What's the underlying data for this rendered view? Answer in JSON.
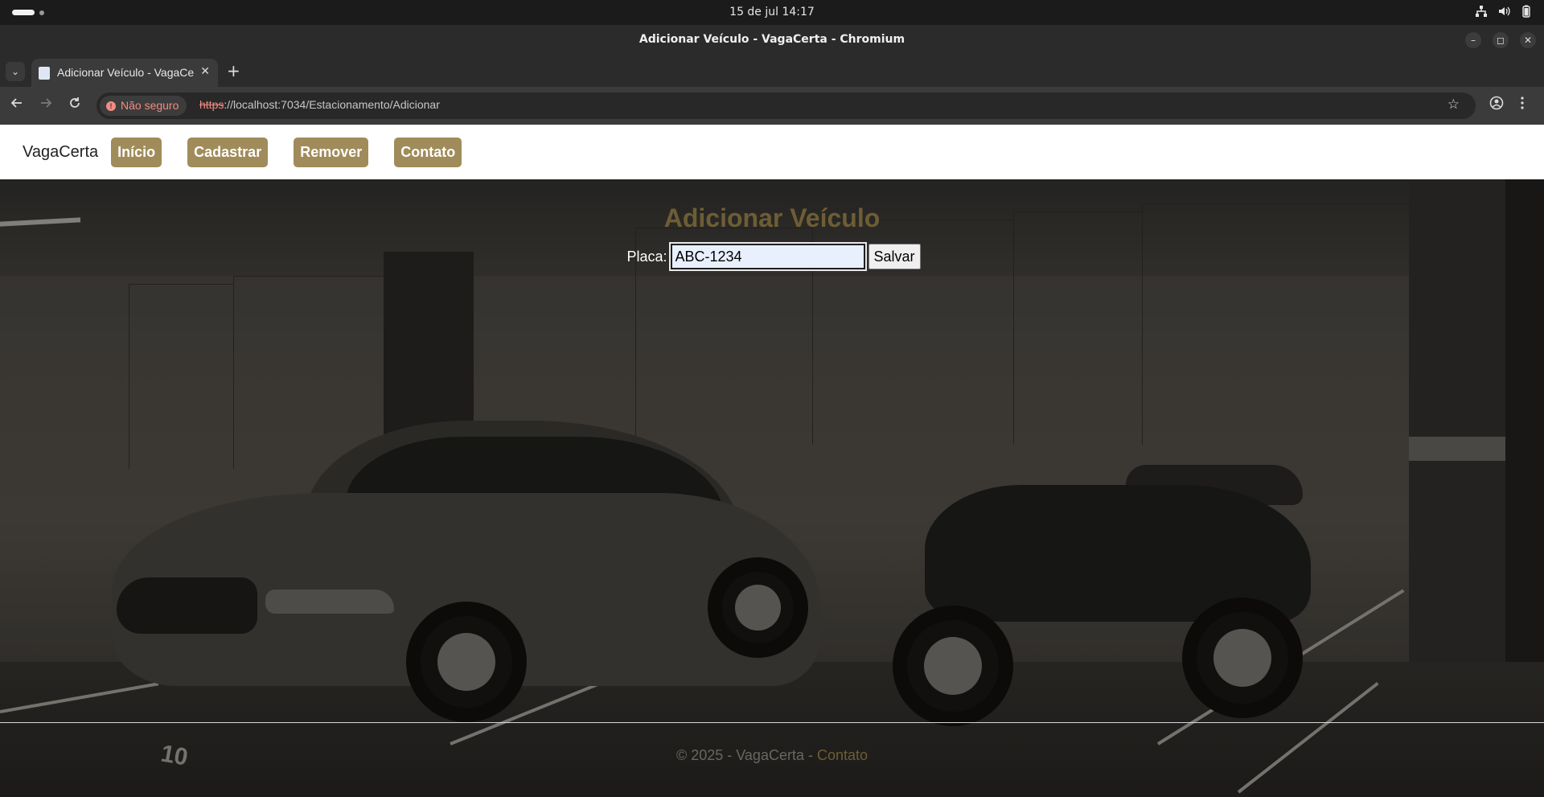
{
  "os": {
    "clock": "15 de jul  14:17",
    "tray_icons": [
      "network-icon",
      "volume-icon",
      "battery-icon"
    ]
  },
  "window": {
    "title": "Adicionar Veículo - VagaCerta - Chromium",
    "minimize": "–",
    "maximize": "◻",
    "close": "✕"
  },
  "browser": {
    "tab_title": "Adicionar Veículo - VagaCerta",
    "tab_close": "✕",
    "new_tab": "+",
    "tab_menu": "⌄",
    "security_label": "Não seguro",
    "url_scheme": "https",
    "url_rest": "://localhost:7034/Estacionamento/Adicionar"
  },
  "site": {
    "brand": "VagaCerta",
    "nav": [
      {
        "label": "Início"
      },
      {
        "label": "Cadastrar"
      },
      {
        "label": "Remover"
      },
      {
        "label": "Contato"
      }
    ],
    "page_title": "Adicionar Veículo",
    "form": {
      "label": "Placa:",
      "value": "ABC-1234",
      "submit": "Salvar"
    },
    "footer": {
      "copyright": "© 2025 - VagaCerta - ",
      "link": "Contato"
    }
  },
  "colors": {
    "nav_button": "#a08c5a",
    "title": "#6e5d35",
    "input_bg": "#e8f0fe"
  }
}
